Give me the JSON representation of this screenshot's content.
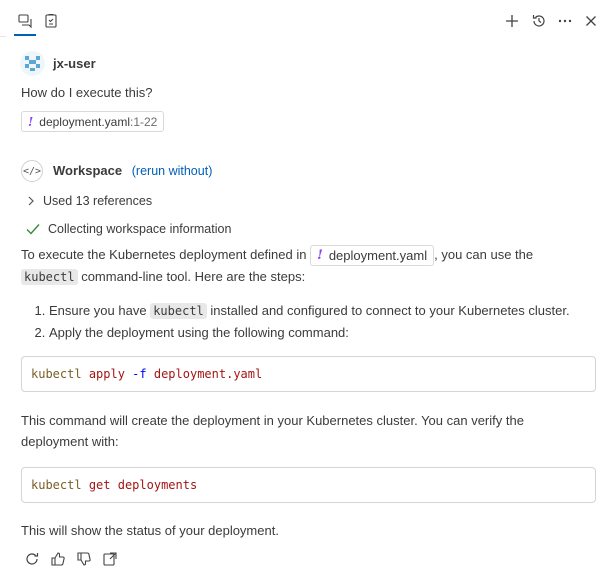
{
  "header": {
    "chat_tab_icon": "chat-icon",
    "edits_tab_icon": "edits-icon",
    "actions": [
      "add-icon",
      "history-icon",
      "more-icon",
      "close-icon"
    ]
  },
  "user": {
    "name": "jx-user",
    "question": "How do I execute this?",
    "attachment": {
      "file": "deployment.yaml",
      "range": ":1-22"
    }
  },
  "response": {
    "agent": "Workspace",
    "rerun_link": "(rerun without)",
    "references_label": "Used 13 references",
    "progress_label": "Collecting workspace information",
    "intro_part1": "To execute the Kubernetes deployment defined in",
    "intro_file": "deployment.yaml",
    "intro_part2": ", you can use the",
    "intro_tool": "kubectl",
    "intro_part3": "command-line tool. Here are the steps:",
    "steps": [
      {
        "pre": "Ensure you have",
        "code": "kubectl",
        "post": "installed and configured to connect to your Kubernetes cluster."
      },
      {
        "pre": "Apply the deployment using the following command:",
        "code": "",
        "post": ""
      }
    ],
    "code1": {
      "cmd": "kubectl",
      "sub": "apply",
      "flag": "-f",
      "arg": "deployment.yaml"
    },
    "para2": "This command will create the deployment in your Kubernetes cluster. You can verify the deployment with:",
    "code2": {
      "cmd": "kubectl",
      "sub": "get",
      "arg": "deployments"
    },
    "para3": "This will show the status of your deployment."
  },
  "footer_actions": [
    "retry-icon",
    "thumbs-up-icon",
    "thumbs-down-icon",
    "insert-icon"
  ]
}
